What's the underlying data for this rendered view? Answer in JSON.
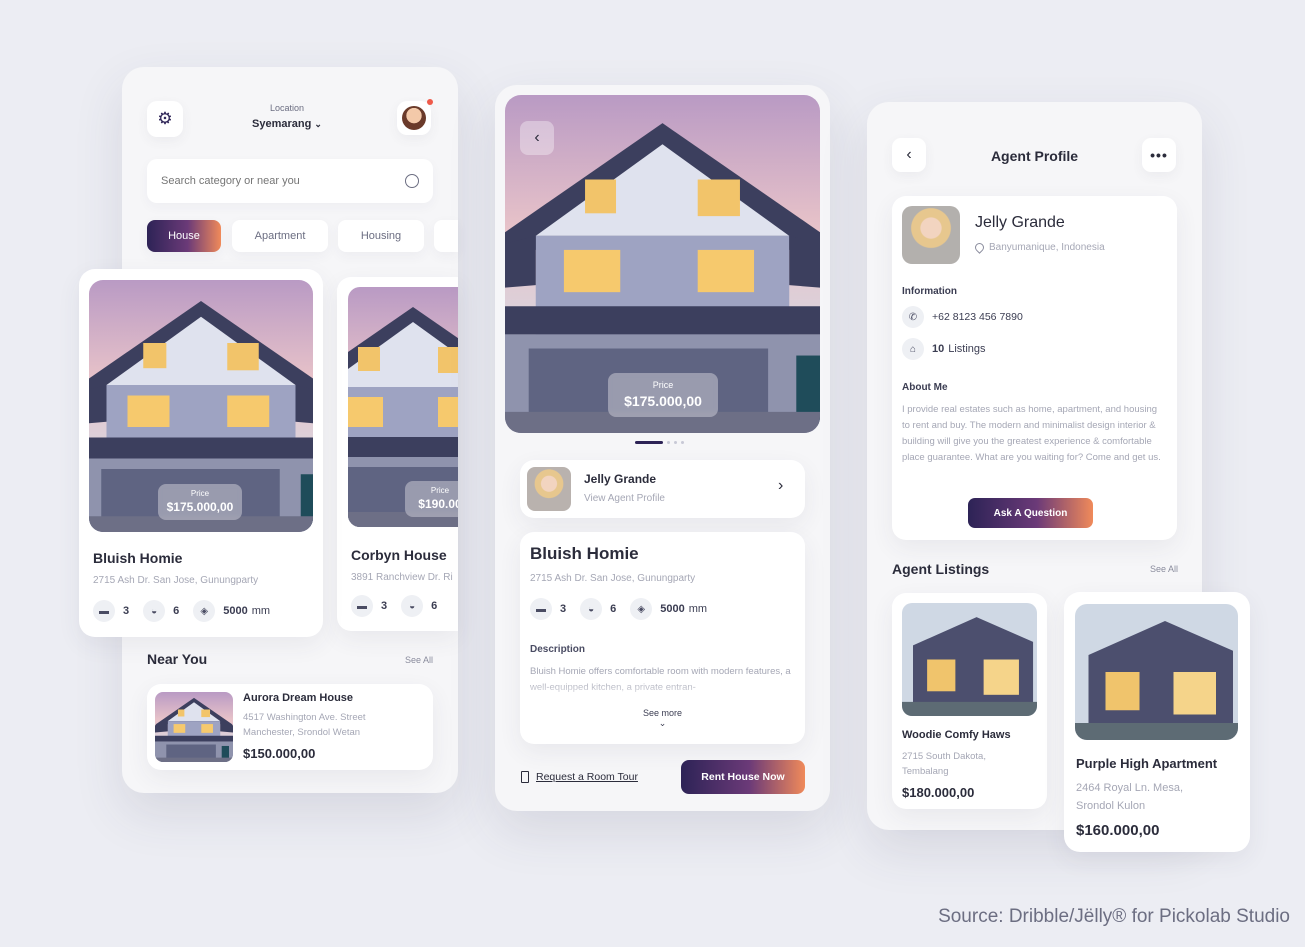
{
  "screen1": {
    "location_label": "Location",
    "location_value": "Syemarang",
    "search_placeholder": "Search category or near you",
    "chips": [
      "House",
      "Apartment",
      "Housing"
    ],
    "card1": {
      "price_label": "Price",
      "price": "$175.000,00",
      "name": "Bluish Homie",
      "address": "2715 Ash Dr. San Jose, Gunungparty",
      "beds": "3",
      "baths": "6",
      "area": "5000",
      "area_unit": "mm"
    },
    "card2": {
      "price_label": "Price",
      "price": "$190.00",
      "name": "Corbyn House",
      "address": "3891 Ranchview Dr. Ri",
      "beds": "3",
      "baths": "6"
    },
    "near_you": {
      "title": "Near You",
      "see_all": "See All",
      "item": {
        "name": "Aurora Dream House",
        "address": "4517 Washington Ave. Street Manchester, Srondol Wetan",
        "price": "$150.000,00"
      }
    }
  },
  "screen2": {
    "price_label": "Price",
    "price": "$175.000,00",
    "agent": {
      "name": "Jelly Grande",
      "link": "View Agent Profile"
    },
    "house": {
      "name": "Bluish Homie",
      "address": "2715 Ash Dr. San Jose, Gunungparty",
      "beds": "3",
      "baths": "6",
      "area": "5000",
      "area_unit": "mm"
    },
    "description_title": "Description",
    "description": "Bluish Homie offers comfortable room with modern features, a well-equipped kitchen, a private entran-",
    "see_more": "See more",
    "tour_link": "Request a Room Tour",
    "rent_button": "Rent House Now"
  },
  "screen3": {
    "title": "Agent Profile",
    "agent": {
      "name": "Jelly Grande",
      "location": "Banyumanique, Indonesia"
    },
    "information_title": "Information",
    "phone": "+62 8123 456 7890",
    "listings_count": "10",
    "listings_word": "Listings",
    "about_title": "About Me",
    "about": "I provide real estates such as home, apartment, and housing to rent and buy. The modern and minimalist design interior & building will give you the greatest experience & comfortable place guarantee. What are you waiting for? Come and get us.",
    "ask_button": "Ask A Question",
    "listings_title": "Agent Listings",
    "see_all": "See All",
    "listing1": {
      "name": "Woodie Comfy Haws",
      "address": "2715 South Dakota, Tembalang",
      "price": "$180.000,00"
    },
    "listing2": {
      "name": "Purple High Apartment",
      "address": "2464 Royal Ln. Mesa, Srondol Kulon",
      "price": "$160.000,00"
    }
  },
  "source": "Source: Dribble/Jëlly® for Pickolab Studio",
  "colors": {
    "accent_dark": "#2d2356",
    "accent_orange": "#f08a5a",
    "background": "#ecedf3"
  }
}
